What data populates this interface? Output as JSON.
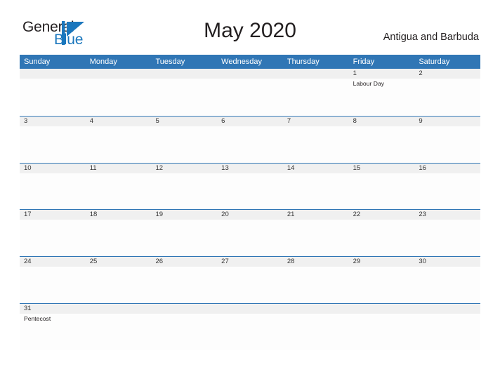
{
  "brand": {
    "name_part1": "General",
    "name_part2": "Blue",
    "flag_icon": "blue-flag-icon",
    "color_dark": "#231f20",
    "color_blue": "#1b77bd"
  },
  "header": {
    "title": "May 2020",
    "region": "Antigua and Barbuda"
  },
  "theme": {
    "header_blue": "#3076b5",
    "row_band_gray": "#f0f0f0",
    "row_rule_blue": "#3076b5",
    "text_dark": "#333333"
  },
  "weekdays": [
    {
      "label": "Sunday"
    },
    {
      "label": "Monday"
    },
    {
      "label": "Tuesday"
    },
    {
      "label": "Wednesday"
    },
    {
      "label": "Thursday"
    },
    {
      "label": "Friday"
    },
    {
      "label": "Saturday"
    }
  ],
  "weeks": [
    {
      "days": [
        {
          "num": "",
          "event": ""
        },
        {
          "num": "",
          "event": ""
        },
        {
          "num": "",
          "event": ""
        },
        {
          "num": "",
          "event": ""
        },
        {
          "num": "",
          "event": ""
        },
        {
          "num": "1",
          "event": "Labour Day"
        },
        {
          "num": "2",
          "event": ""
        }
      ]
    },
    {
      "days": [
        {
          "num": "3",
          "event": ""
        },
        {
          "num": "4",
          "event": ""
        },
        {
          "num": "5",
          "event": ""
        },
        {
          "num": "6",
          "event": ""
        },
        {
          "num": "7",
          "event": ""
        },
        {
          "num": "8",
          "event": ""
        },
        {
          "num": "9",
          "event": ""
        }
      ]
    },
    {
      "days": [
        {
          "num": "10",
          "event": ""
        },
        {
          "num": "11",
          "event": ""
        },
        {
          "num": "12",
          "event": ""
        },
        {
          "num": "13",
          "event": ""
        },
        {
          "num": "14",
          "event": ""
        },
        {
          "num": "15",
          "event": ""
        },
        {
          "num": "16",
          "event": ""
        }
      ]
    },
    {
      "days": [
        {
          "num": "17",
          "event": ""
        },
        {
          "num": "18",
          "event": ""
        },
        {
          "num": "19",
          "event": ""
        },
        {
          "num": "20",
          "event": ""
        },
        {
          "num": "21",
          "event": ""
        },
        {
          "num": "22",
          "event": ""
        },
        {
          "num": "23",
          "event": ""
        }
      ]
    },
    {
      "days": [
        {
          "num": "24",
          "event": ""
        },
        {
          "num": "25",
          "event": ""
        },
        {
          "num": "26",
          "event": ""
        },
        {
          "num": "27",
          "event": ""
        },
        {
          "num": "28",
          "event": ""
        },
        {
          "num": "29",
          "event": ""
        },
        {
          "num": "30",
          "event": ""
        }
      ]
    },
    {
      "days": [
        {
          "num": "31",
          "event": "Pentecost"
        },
        {
          "num": "",
          "event": ""
        },
        {
          "num": "",
          "event": ""
        },
        {
          "num": "",
          "event": ""
        },
        {
          "num": "",
          "event": ""
        },
        {
          "num": "",
          "event": ""
        },
        {
          "num": "",
          "event": ""
        }
      ]
    }
  ]
}
